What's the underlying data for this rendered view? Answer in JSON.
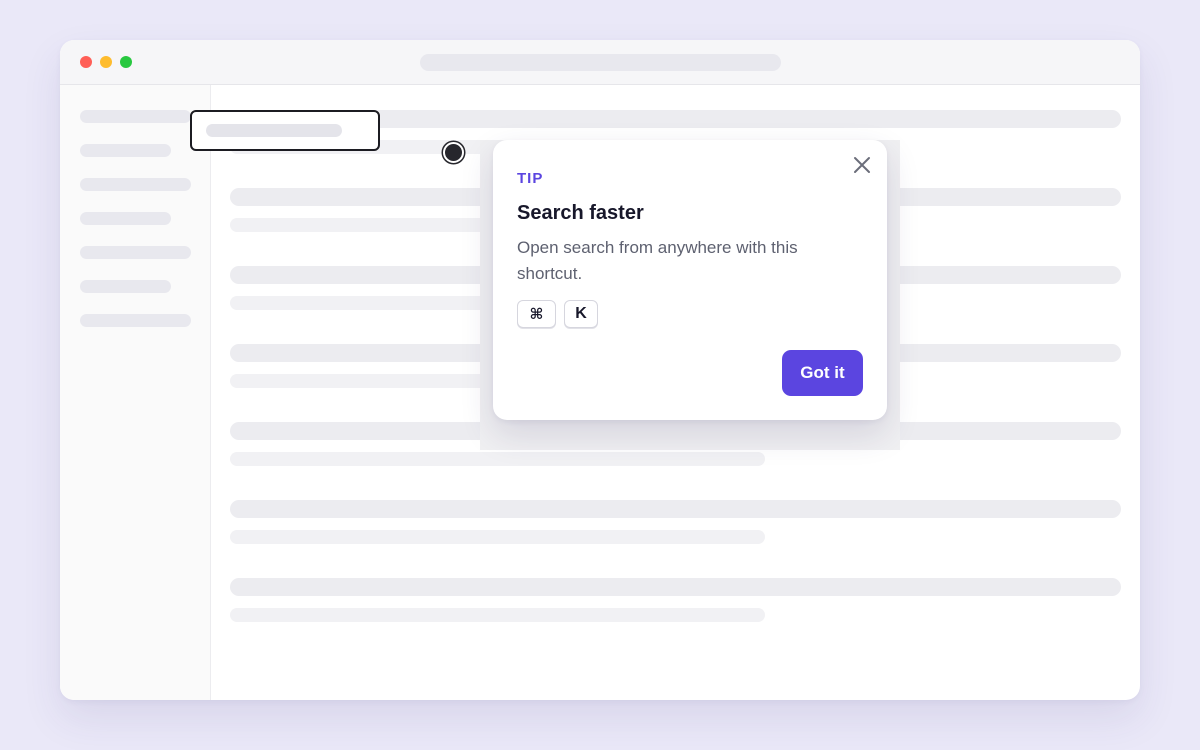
{
  "colors": {
    "accent": "#5B45E0",
    "page_background": "#EAE8F8",
    "title": "#17172A",
    "body_text": "#5E6170",
    "traffic_light_red": "#FF5F57",
    "traffic_light_yellow": "#FEBC2E",
    "traffic_light_green": "#28C840"
  },
  "window": {
    "traffic_lights": [
      "close",
      "minimize",
      "maximize"
    ],
    "content_state": "skeleton placeholders"
  },
  "tooltip": {
    "label": "TIP",
    "title": "Search faster",
    "body": "Open search from anywhere with this shortcut.",
    "shortcut_keys": [
      "⌘",
      "K"
    ],
    "primary_button": "Got it",
    "close_icon": "close-icon"
  },
  "icons": {
    "close": "close-icon",
    "beacon": "beacon-dot-icon"
  }
}
